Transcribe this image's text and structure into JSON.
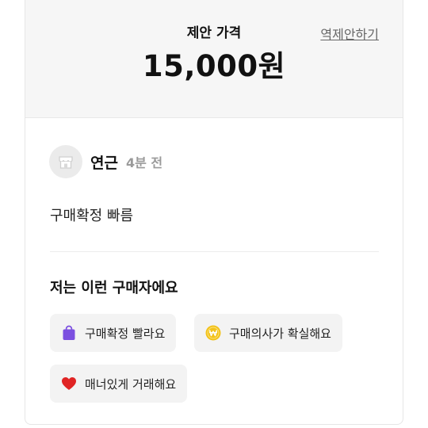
{
  "offer": {
    "label": "제안 가격",
    "price": "15,000원",
    "counter_link": "역제안하기"
  },
  "buyer": {
    "name": "연근",
    "time": "4분 전",
    "review": "구매확정 빠름"
  },
  "traits": {
    "title": "저는 이런 구매자에요",
    "tags": [
      {
        "label": "구매확정 빨라요",
        "icon": "shopping-bag-icon",
        "color": "#7b4fe0"
      },
      {
        "label": "구매의사가 확실해요",
        "icon": "won-coin-icon",
        "color": "#f2c21b"
      },
      {
        "label": "매너있게 거래해요",
        "icon": "heart-icon",
        "color": "#e02424"
      }
    ]
  }
}
